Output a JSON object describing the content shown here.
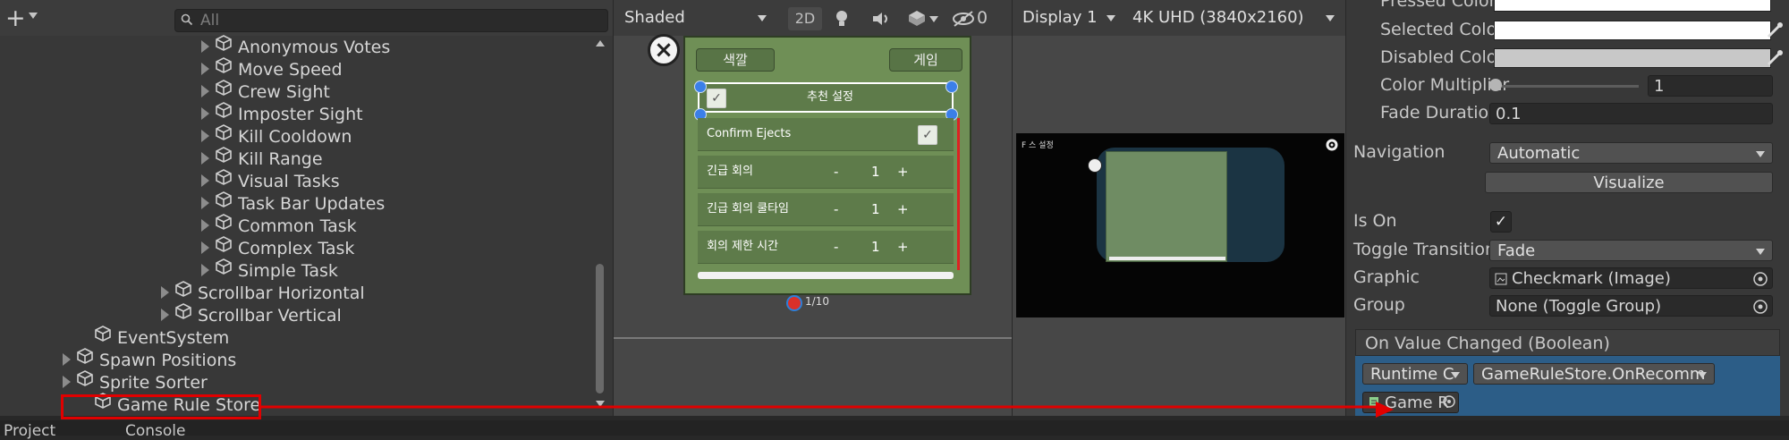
{
  "hierarchy": {
    "search_placeholder": "All",
    "items": [
      {
        "label": "Anonymous Votes",
        "expandable": true
      },
      {
        "label": "Move Speed",
        "expandable": true
      },
      {
        "label": "Crew Sight",
        "expandable": true
      },
      {
        "label": "Imposter Sight",
        "expandable": true
      },
      {
        "label": "Kill Cooldown",
        "expandable": true
      },
      {
        "label": "Kill Range",
        "expandable": true
      },
      {
        "label": "Visual Tasks",
        "expandable": true
      },
      {
        "label": "Task Bar Updates",
        "expandable": true
      },
      {
        "label": "Common Task",
        "expandable": true
      },
      {
        "label": "Complex Task",
        "expandable": true
      },
      {
        "label": "Simple Task",
        "expandable": true
      },
      {
        "label": "Scrollbar Horizontal",
        "expandable": true
      },
      {
        "label": "Scrollbar Vertical",
        "expandable": true
      },
      {
        "label": "EventSystem",
        "expandable": false
      },
      {
        "label": "Spawn Positions",
        "expandable": true
      },
      {
        "label": "Sprite Sorter",
        "expandable": true
      },
      {
        "label": "Game Rule Store",
        "expandable": false
      }
    ]
  },
  "bottom_tabs": {
    "project": "Project",
    "console": "Console"
  },
  "scene": {
    "shading": "Shaded",
    "mode_2d": "2D",
    "hidden_count": "0",
    "panel": {
      "btn_color": "색깔",
      "btn_game": "게임",
      "recommend_label": "추천 설정",
      "confirm_ejects": "Confirm Ejects",
      "rows": [
        {
          "label": "긴급 회의",
          "minus": "-",
          "value": "1",
          "plus": "+"
        },
        {
          "label": "긴급 회의 쿨타임",
          "minus": "-",
          "value": "1",
          "plus": "+"
        },
        {
          "label": "회의 제한 시간",
          "minus": "-",
          "value": "1",
          "plus": "+"
        }
      ],
      "player_count": "1/10"
    }
  },
  "game": {
    "display": "Display 1",
    "resolution": "4K UHD (3840x2160)",
    "mini_title": "F 스 설정"
  },
  "inspector": {
    "pressed_color_label": "Pressed Color",
    "selected_color_label": "Selected Color",
    "disabled_color_label": "Disabled Color",
    "color_multiplier_label": "Color Multiplier",
    "color_multiplier_value": "1",
    "color_multiplier_level": 0.0,
    "fade_duration_label": "Fade Duration",
    "fade_duration_value": "0.1",
    "navigation_label": "Navigation",
    "navigation_value": "Automatic",
    "visualize_label": "Visualize",
    "is_on_label": "Is On",
    "is_on_checked": true,
    "toggle_transition_label": "Toggle Transition",
    "toggle_transition_value": "Fade",
    "graphic_label": "Graphic",
    "graphic_value": "Checkmark (Image)",
    "group_label": "Group",
    "group_value": "None (Toggle Group)",
    "event_header": "On Value Changed (Boolean)",
    "runtime_value": "Runtime C",
    "function_value": "GameRuleStore.OnRecomm",
    "object_value": "Game R"
  },
  "colors": {
    "highlight": "#e10000",
    "panel_green": "#6f8f56",
    "event_blue": "#2c5d87"
  }
}
